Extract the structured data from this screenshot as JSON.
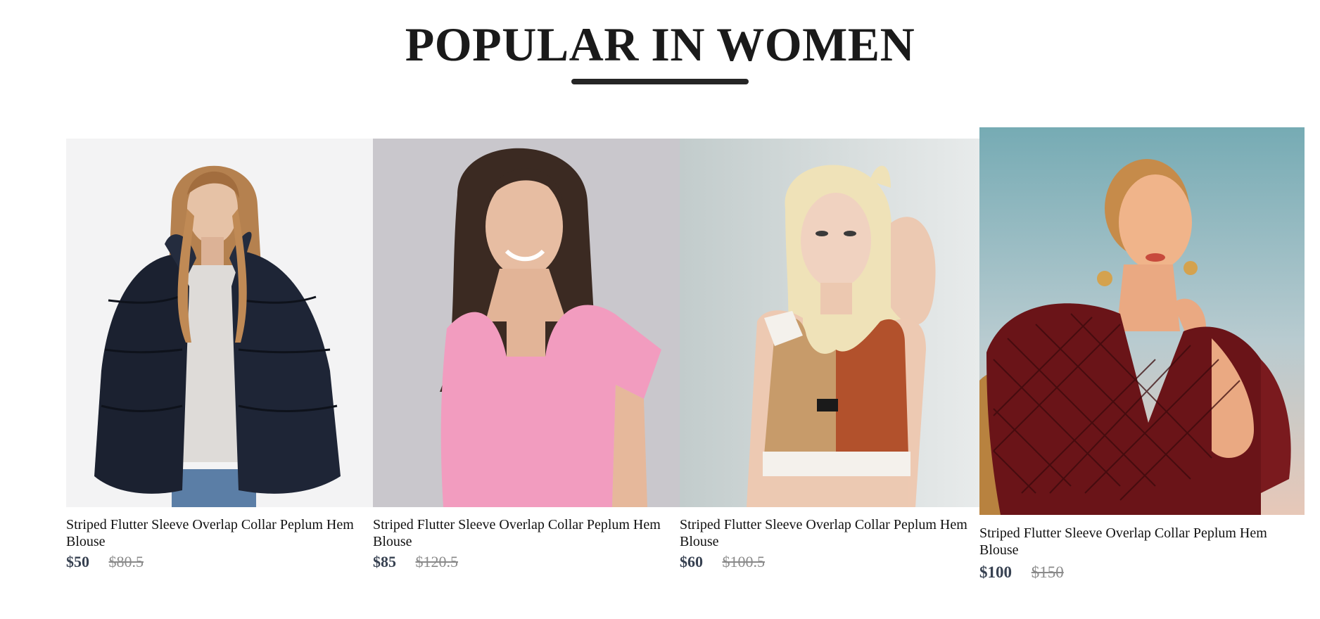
{
  "section": {
    "title": "POPULAR IN WOMEN"
  },
  "products": [
    {
      "name": "Striped Flutter Sleeve Overlap Collar Peplum Hem Blouse",
      "new_price": "$50",
      "old_price": "$80.5",
      "image_subject": "woman in dark fur puffer jacket"
    },
    {
      "name": "Striped Flutter Sleeve Overlap Collar Peplum Hem Blouse",
      "new_price": "$85",
      "old_price": "$120.5",
      "image_subject": "woman in pink square-neck top"
    },
    {
      "name": "Striped Flutter Sleeve Overlap Collar Peplum Hem Blouse",
      "new_price": "$60",
      "old_price": "$100.5",
      "image_subject": "woman in tan and rust sports bra"
    },
    {
      "name": "Striped Flutter Sleeve Overlap Collar Peplum Hem Blouse",
      "new_price": "$100",
      "old_price": "$150",
      "image_subject": "woman in red patterned wrap blouse"
    }
  ],
  "colors": {
    "title": "#1a1a1a",
    "new_price": "#374151",
    "old_price": "#8a8a8a"
  }
}
